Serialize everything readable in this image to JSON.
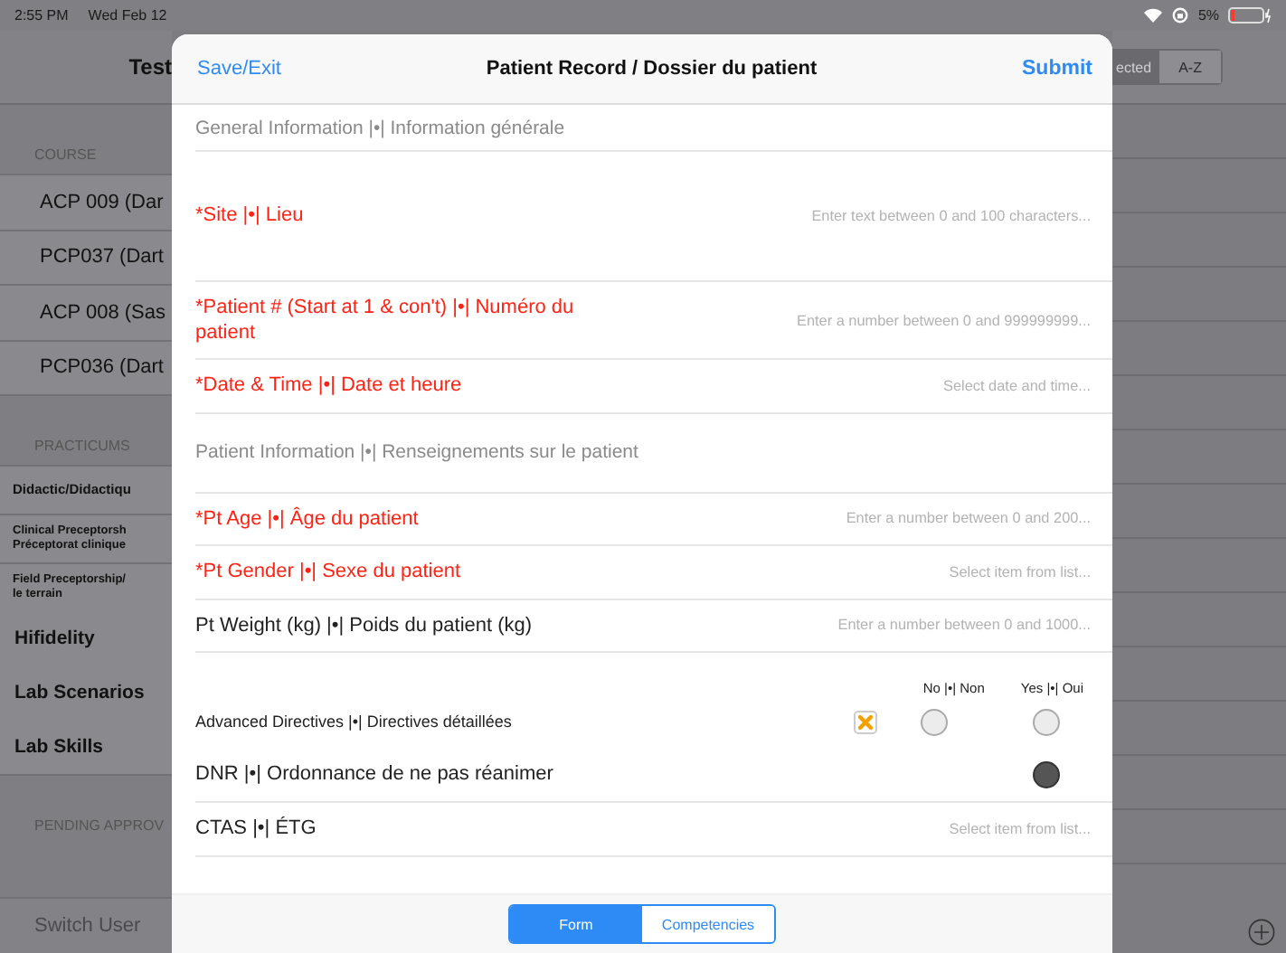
{
  "status_bar": {
    "time": "2:55 PM",
    "date": "Wed Feb 12",
    "battery": "5%"
  },
  "background_app": {
    "title": "Test",
    "sections": [
      {
        "header": "COURSE",
        "items": [
          {
            "label": "ACP 009 (Dar",
            "kind": "course"
          },
          {
            "label": "PCP037 (Dart",
            "kind": "course"
          },
          {
            "label": "ACP 008 (Sas",
            "kind": "course"
          },
          {
            "label": "PCP036 (Dart",
            "kind": "course"
          }
        ]
      },
      {
        "header": "PRACTICUMS",
        "items": [
          {
            "label": "Didactic/Didactiqu",
            "kind": "small"
          },
          {
            "label": "Clinical Preceptorsh\nPréceptorat clinique",
            "kind": "small"
          },
          {
            "label": "Field Preceptorship/\nle terrain",
            "kind": "small"
          },
          {
            "label": "Hifidelity",
            "kind": "large"
          },
          {
            "label": "Lab Scenarios",
            "kind": "large"
          },
          {
            "label": "Lab Skills",
            "kind": "large"
          }
        ]
      },
      {
        "header": "PENDING APPROV"
      }
    ],
    "footer_link": "Switch User",
    "sort_segments": [
      {
        "label": "ected",
        "selected": true
      },
      {
        "label": "A-Z",
        "selected": false
      }
    ]
  },
  "modal": {
    "left_button": "Save/Exit",
    "title": "Patient Record / Dossier du patient",
    "right_button": "Submit",
    "sections": [
      {
        "title": "General Information |•| Information générale",
        "fields": [
          {
            "kind": "textarea",
            "label": "*Site |•| Lieu",
            "required": true,
            "placeholder": "Enter text between 0 and 100 characters..."
          },
          {
            "kind": "number",
            "label": "*Patient # (Start at 1 & con't) |•| Numéro du patient",
            "required": true,
            "placeholder": "Enter a number between 0 and 999999999..."
          },
          {
            "kind": "datetime",
            "label": "*Date & Time  |•|  Date et heure",
            "required": true,
            "placeholder": "Select date and time..."
          }
        ]
      },
      {
        "title": "Patient Information |•| Renseignements sur le patient",
        "fields": [
          {
            "kind": "number",
            "label": "*Pt Age |•| Âge du patient",
            "required": true,
            "placeholder": "Enter a number between 0 and 200..."
          },
          {
            "kind": "select",
            "label": "*Pt Gender |•| Sexe du patient",
            "required": true,
            "placeholder": "Select item from list..."
          },
          {
            "kind": "number",
            "label": "Pt Weight (kg) |•| Poids du patient (kg)",
            "required": false,
            "placeholder": "Enter a number between 0 and 1000..."
          },
          {
            "kind": "radio_header",
            "columns": [
              "No |•| Non",
              "Yes |•| Oui"
            ]
          },
          {
            "kind": "radio",
            "label": "Advanced Directives |•| Directives détaillées",
            "required": false,
            "cleared": true,
            "choices": [
              {
                "selected": false
              },
              {
                "selected": false
              }
            ]
          },
          {
            "kind": "radio",
            "label": "DNR |•| Ordonnance de ne pas réanimer",
            "required": false,
            "cleared": false,
            "choices": [
              {
                "hidden": true
              },
              {
                "selected": true
              }
            ]
          },
          {
            "kind": "select",
            "label": "CTAS |•| ÉTG",
            "required": false,
            "placeholder": "Select item from list..."
          }
        ]
      }
    ],
    "tabs": [
      {
        "label": "Form",
        "selected": true
      },
      {
        "label": "Competencies",
        "selected": false
      }
    ]
  }
}
